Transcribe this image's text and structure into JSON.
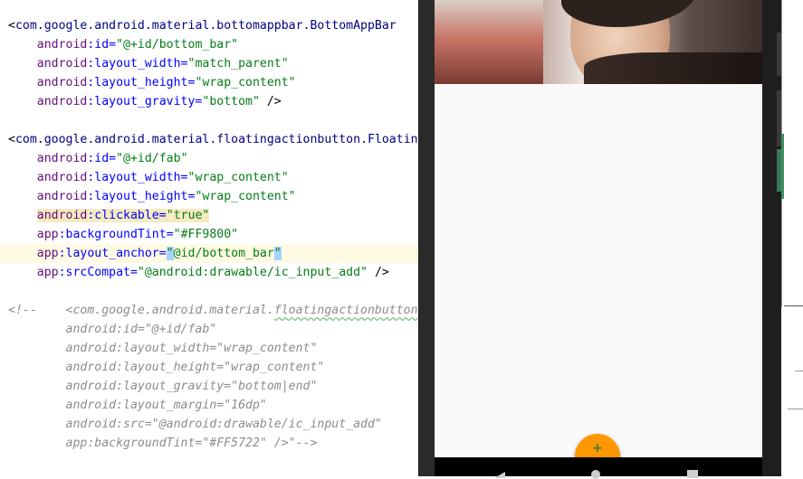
{
  "editor": {
    "lines": [
      {
        "id": "l1",
        "parts": [
          {
            "t": "<",
            "c": "punct"
          },
          {
            "t": "com.google.android.material.bottomappbar.BottomAppBar",
            "c": "tag"
          }
        ]
      },
      {
        "id": "l2",
        "parts": [
          {
            "t": "    android",
            "c": "ns"
          },
          {
            "t": ":id=",
            "c": "attr"
          },
          {
            "t": "\"@+id/bottom_bar\"",
            "c": "val"
          }
        ]
      },
      {
        "id": "l3",
        "parts": [
          {
            "t": "    android",
            "c": "ns"
          },
          {
            "t": ":layout_width=",
            "c": "attr"
          },
          {
            "t": "\"match_parent\"",
            "c": "val"
          }
        ]
      },
      {
        "id": "l4",
        "parts": [
          {
            "t": "    android",
            "c": "ns"
          },
          {
            "t": ":layout_height=",
            "c": "attr"
          },
          {
            "t": "\"wrap_content\"",
            "c": "val"
          }
        ]
      },
      {
        "id": "l5",
        "parts": [
          {
            "t": "    android",
            "c": "ns"
          },
          {
            "t": ":layout_gravity=",
            "c": "attr"
          },
          {
            "t": "\"bottom\"",
            "c": "val"
          },
          {
            "t": " />",
            "c": "punct"
          }
        ]
      },
      {
        "id": "l6",
        "parts": []
      },
      {
        "id": "l7",
        "parts": [
          {
            "t": "<",
            "c": "punct"
          },
          {
            "t": "com.google.android.material.floatingactionbutton.FloatingActionButton",
            "c": "tag"
          }
        ]
      },
      {
        "id": "l8",
        "parts": [
          {
            "t": "    android",
            "c": "ns"
          },
          {
            "t": ":id=",
            "c": "attr"
          },
          {
            "t": "\"@+id/fab\"",
            "c": "val"
          }
        ]
      },
      {
        "id": "l9",
        "parts": [
          {
            "t": "    android",
            "c": "ns"
          },
          {
            "t": ":layout_width=",
            "c": "attr"
          },
          {
            "t": "\"wrap_content\"",
            "c": "val"
          }
        ]
      },
      {
        "id": "l10",
        "parts": [
          {
            "t": "    android",
            "c": "ns"
          },
          {
            "t": ":layout_height=",
            "c": "attr"
          },
          {
            "t": "\"wrap_content\"",
            "c": "val"
          }
        ]
      },
      {
        "id": "l11",
        "parts": [
          {
            "t": "    ",
            "c": "punct"
          },
          {
            "t": "android",
            "c": "ns attr-hl"
          },
          {
            "t": ":clickable=",
            "c": "attr attr-hl"
          },
          {
            "t": "\"true\"",
            "c": "val attr-hl"
          }
        ]
      },
      {
        "id": "l12",
        "parts": [
          {
            "t": "    app",
            "c": "ns"
          },
          {
            "t": ":backgroundTint=",
            "c": "attr"
          },
          {
            "t": "\"#FF9800\"",
            "c": "val"
          }
        ]
      },
      {
        "id": "l13",
        "highlight": true,
        "parts": [
          {
            "t": "    app",
            "c": "ns"
          },
          {
            "t": ":layout_anchor=",
            "c": "attr"
          },
          {
            "t": "\"",
            "c": "val quote-cursor"
          },
          {
            "t": "@id/bottom_bar",
            "c": "val"
          },
          {
            "t": "\"",
            "c": "val quote-cursor"
          }
        ]
      },
      {
        "id": "l14",
        "parts": [
          {
            "t": "    app",
            "c": "ns"
          },
          {
            "t": ":srcCompat=",
            "c": "attr"
          },
          {
            "t": "\"@android:drawable/ic_input_add\"",
            "c": "val"
          },
          {
            "t": " />",
            "c": "punct"
          }
        ]
      },
      {
        "id": "l15",
        "parts": []
      },
      {
        "id": "l16",
        "parts": [
          {
            "t": "<!--    <com.google.android.material.",
            "c": "comment"
          },
          {
            "t": "floatingactionbutton",
            "c": "comment squiggle"
          },
          {
            "t": ".FloatingActionButton",
            "c": "comment"
          }
        ]
      },
      {
        "id": "l17",
        "parts": [
          {
            "t": "        android:id=\"@+id/fab\"",
            "c": "comment"
          }
        ]
      },
      {
        "id": "l18",
        "parts": [
          {
            "t": "        android:layout_width=\"wrap_content\"",
            "c": "comment"
          }
        ]
      },
      {
        "id": "l19",
        "parts": [
          {
            "t": "        android:layout_height=\"wrap_content\"",
            "c": "comment"
          }
        ]
      },
      {
        "id": "l20",
        "parts": [
          {
            "t": "        android:layout_gravity=\"bottom|end\"",
            "c": "comment"
          }
        ]
      },
      {
        "id": "l21",
        "parts": [
          {
            "t": "        android:layout_margin=\"16dp\"",
            "c": "comment"
          }
        ]
      },
      {
        "id": "l22",
        "parts": [
          {
            "t": "        android:src=\"@android:drawable/ic_input_add\"",
            "c": "comment"
          }
        ]
      },
      {
        "id": "l23",
        "parts": [
          {
            "t": "        app:backgroundTint=\"#FF5722\" />\"-->",
            "c": "comment"
          }
        ]
      }
    ]
  },
  "device": {
    "fab_icon": "+",
    "fab_color": "#FF9800",
    "nav_buttons": [
      "back-icon",
      "home-icon",
      "recents-icon"
    ]
  }
}
